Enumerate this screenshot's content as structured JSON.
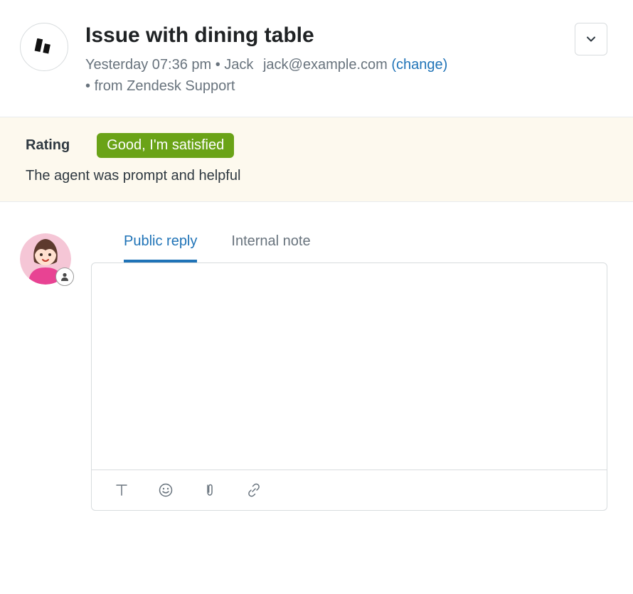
{
  "header": {
    "title": "Issue with dining table",
    "timestamp": "Yesterday 07:36 pm",
    "requester_name": "Jack",
    "requester_email": "jack@example.com",
    "change_label": "(change)",
    "source": "from Zendesk Support"
  },
  "rating": {
    "label": "Rating",
    "value": "Good, I'm satisfied",
    "comment": "The agent was prompt and helpful"
  },
  "reply": {
    "tabs": {
      "public": "Public reply",
      "internal": "Internal note"
    }
  }
}
